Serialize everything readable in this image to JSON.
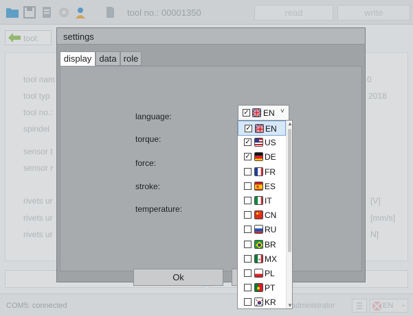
{
  "toolbar": {
    "title": "tool no.: 00001350",
    "read_label": "read",
    "write_label": "write",
    "icons": [
      "folder-icon",
      "save-icon",
      "document-icon",
      "gear-icon",
      "user-icon",
      "sd-card-icon"
    ]
  },
  "back": {
    "label": "tool:"
  },
  "background": {
    "labels": [
      "tool nam",
      "tool typ",
      "tool no.:",
      "spindel",
      "sensor t",
      "sensor r",
      "rivets ur",
      "rivets ur",
      "rivets ur"
    ],
    "right_values": [
      "0",
      "2018",
      "[V]",
      "[mm/s]",
      "N]"
    ]
  },
  "status": {
    "connection": "COM5: connected",
    "user": "administrator",
    "lang": "EN"
  },
  "dialog": {
    "title": "settings",
    "tabs": [
      "display",
      "data",
      "role"
    ],
    "active_tab": "display",
    "fields": [
      "language:",
      "torque:",
      "force:",
      "stroke:",
      "temperature:"
    ],
    "combo": {
      "value": "EN",
      "checked": true
    },
    "ok_label": "Ok",
    "languages": [
      {
        "code": "EN",
        "checked": true,
        "selected": true,
        "flag": "uk"
      },
      {
        "code": "US",
        "checked": true,
        "selected": false,
        "flag": "us"
      },
      {
        "code": "DE",
        "checked": true,
        "selected": false,
        "flag": "de"
      },
      {
        "code": "FR",
        "checked": false,
        "selected": false,
        "flag": "fr"
      },
      {
        "code": "ES",
        "checked": false,
        "selected": false,
        "flag": "es"
      },
      {
        "code": "IT",
        "checked": false,
        "selected": false,
        "flag": "it"
      },
      {
        "code": "CN",
        "checked": false,
        "selected": false,
        "flag": "cn"
      },
      {
        "code": "RU",
        "checked": false,
        "selected": false,
        "flag": "ru"
      },
      {
        "code": "BR",
        "checked": false,
        "selected": false,
        "flag": "br"
      },
      {
        "code": "MX",
        "checked": false,
        "selected": false,
        "flag": "mx"
      },
      {
        "code": "PL",
        "checked": false,
        "selected": false,
        "flag": "pl"
      },
      {
        "code": "PT",
        "checked": false,
        "selected": false,
        "flag": "pt"
      },
      {
        "code": "KR",
        "checked": false,
        "selected": false,
        "flag": "kr"
      }
    ]
  },
  "colors": {
    "accent": "#3a8fd6",
    "selection": "#d6e7f7",
    "folder": "#37a0dc",
    "gear": "#c9cdd0"
  }
}
